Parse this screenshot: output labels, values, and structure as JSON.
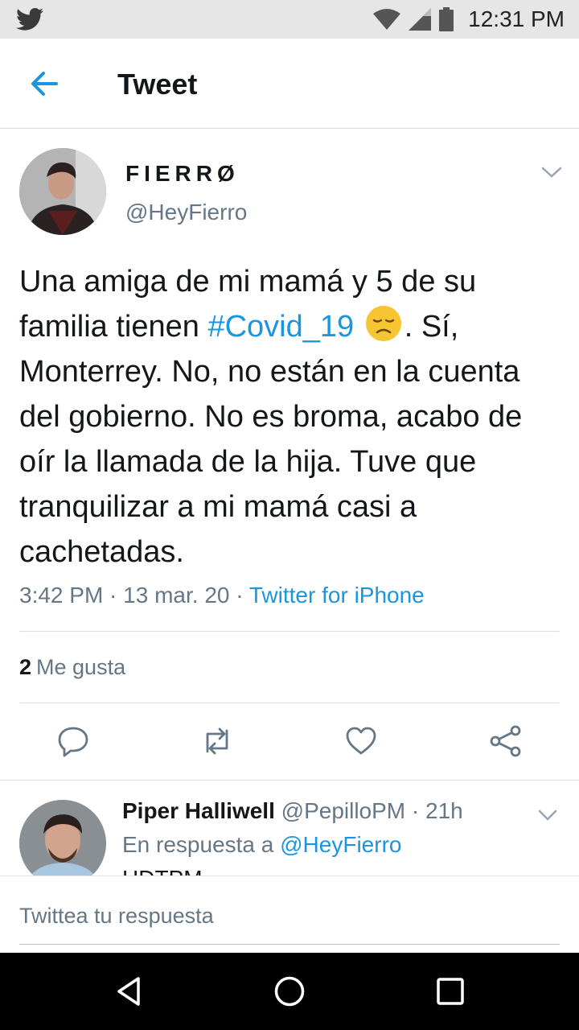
{
  "status_bar": {
    "time": "12:31 PM",
    "icons": [
      "twitter-bird-icon",
      "wifi-icon",
      "signal-icon",
      "battery-icon"
    ]
  },
  "header": {
    "title": "Tweet",
    "back_icon": "back-arrow-icon"
  },
  "tweet": {
    "display_name": "FIERRØ",
    "handle": "@HeyFierro",
    "text_before_hashtag": "Una amiga de mi mamá y 5 de su familia tienen ",
    "hashtag": "#Covid_19",
    "emoji": "disappointed-face-emoji",
    "text_after_emoji": ". Sí, Monterrey. No, no están en la cuenta del gobierno. No es broma, acabo de oír la llamada de la hija. Tuve que tranquilizar a mi mamá casi a cachetadas.",
    "time": "3:42 PM",
    "date": "13 mar. 20",
    "separator": " · ",
    "source": "Twitter for iPhone",
    "likes_count": "2",
    "likes_label": "Me gusta"
  },
  "actions": [
    "reply-icon",
    "retweet-icon",
    "like-icon",
    "share-icon"
  ],
  "reply": {
    "name": "Piper Halliwell",
    "handle": "@PepilloPM",
    "dot": " · ",
    "time": "21h",
    "in_reply_prefix": "En respuesta a ",
    "in_reply_to": "@HeyFierro",
    "text": "HDTPM"
  },
  "compose": {
    "placeholder": "Twittea tu respuesta"
  },
  "colors": {
    "link": "#1b95e0",
    "secondary_text": "#657786",
    "primary_text": "#14171a",
    "status_bar_bg": "#e6e6e6",
    "nav_bar_bg": "#000000"
  }
}
